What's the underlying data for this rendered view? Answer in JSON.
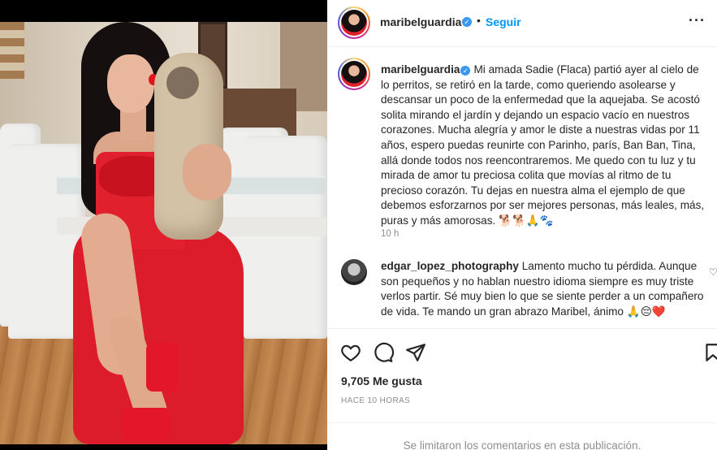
{
  "post": {
    "username": "maribelguardia",
    "verified_mark": "✓",
    "dot": "•",
    "follow_label": "Seguir",
    "more_label": "···"
  },
  "caption": {
    "username": "maribelguardia",
    "text": "Mi amada Sadie (Flaca) partió ayer al cielo de lo perritos, se retiró en la tarde, como queriendo asolearse y descansar un poco de la enfermedad que la aquejaba. Se acostó solita mirando el jardín y dejando un espacio vacío en nuestros corazones. Mucha alegría y amor le diste a nuestras vidas por 11 años, espero puedas reunirte con Parinho, parís, Ban Ban, Tina, allá donde todos nos reencontraremos. Me quedo con tu luz y tu mirada de amor tu preciosa colita que movías al ritmo de tu precioso corazón. Tu dejas en nuestra alma el ejemplo de que debemos esforzarnos por ser mejores personas, más leales, más, puras y más amorosas. 🐕🐕🙏🐾",
    "time": "10 h"
  },
  "comment": {
    "username": "edgar_lopez_photography",
    "text": "Lamento mucho tu pérdida. Aunque son pequeños y no hablan nuestro idioma siempre es muy triste verlos partir. Sé muy bien lo que se siente perder a un compañero de vida. Te mando un gran abrazo Maribel, ánimo 🙏😔❤️",
    "like_icon": "♡"
  },
  "actions": {
    "like_icon": "heart-icon",
    "comment_icon": "speech-bubble-icon",
    "share_icon": "paper-plane-icon",
    "save_icon": "bookmark-icon"
  },
  "stats": {
    "likes_count": "9,705",
    "likes_label": "Me gusta",
    "posted_ago": "HACE 10 HORAS"
  },
  "footer": {
    "comments_disabled": "Se limitaron los comentarios en esta publicación."
  },
  "colors": {
    "accent_blue": "#0095f6",
    "verified_blue": "#3897f0",
    "muted_text": "#8e8e8e",
    "dress_red": "#e0202d"
  }
}
